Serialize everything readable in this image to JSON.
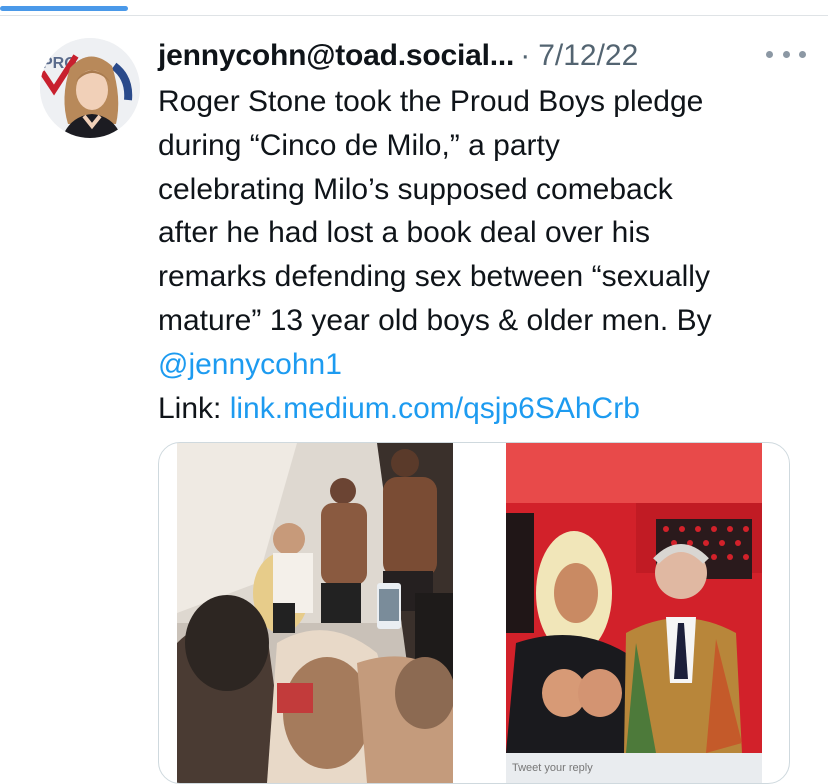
{
  "tweet": {
    "display_name": "jennycohn@toad.social...",
    "separator": "·",
    "date": "7/12/22",
    "text_lines": [
      "Roger Stone took the Proud Boys pledge",
      "during “Cinco de Milo,” a party",
      "celebrating Milo’s supposed comeback",
      "after he had lost a book deal over his",
      "remarks defending sex between “sexually",
      "mature” 13 year old boys & older men. By"
    ],
    "mention": "@jennycohn1",
    "link_label": "Link:",
    "link_url": "link.medium.com/qsjp6SAhCrb"
  },
  "avatar": {
    "logo_text": "PRO"
  },
  "media": {
    "reply_text": "Tweet your reply"
  },
  "colors": {
    "link": "#1d9bf0",
    "text": "#0f1419",
    "secondary": "#536471",
    "tab_indicator": "#4a99e9"
  },
  "icons": [
    "more-icon",
    "avatar-image",
    "party-photo",
    "stone-photo"
  ]
}
